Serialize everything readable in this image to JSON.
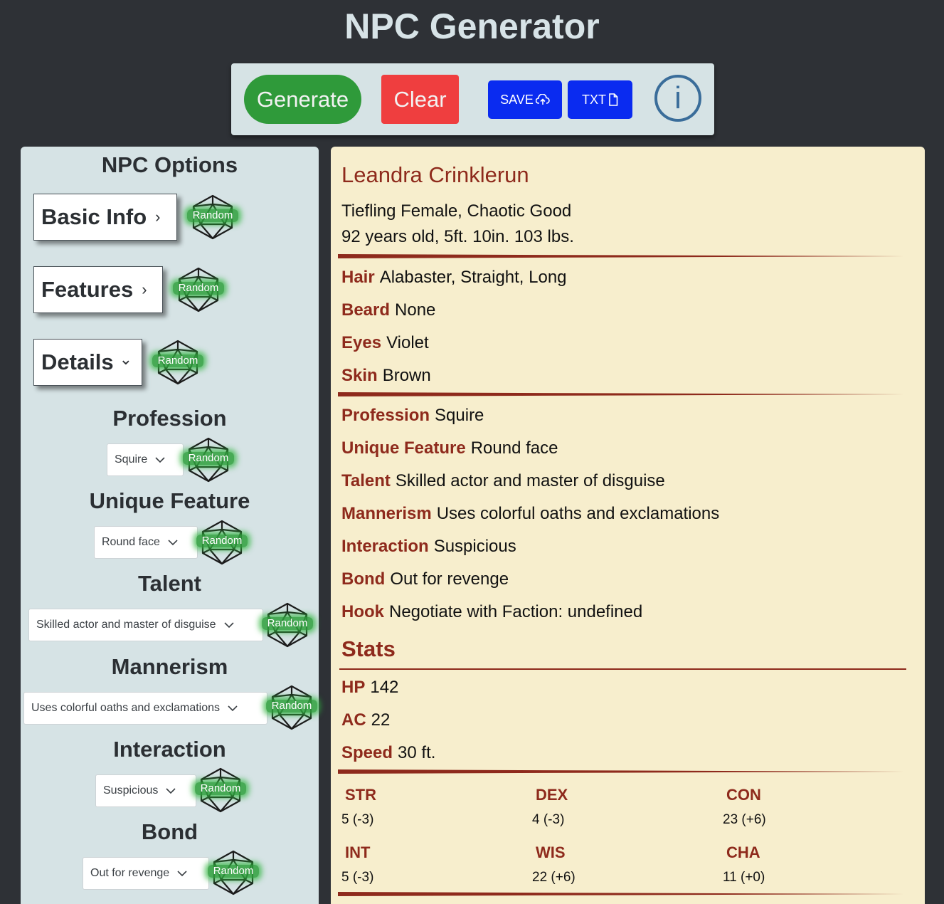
{
  "app": {
    "title": "NPC Generator"
  },
  "toolbar": {
    "generate_label": "Generate",
    "clear_label": "Clear",
    "save_label": "SAVE",
    "txt_label": "TXT",
    "info_label": "i"
  },
  "options": {
    "title": "NPC Options",
    "random_label": "Random",
    "sections": {
      "basic_info": "Basic Info",
      "features": "Features",
      "details": "Details",
      "collapsed_chevron": "›",
      "expanded_chevron": "⌄"
    },
    "fields": {
      "profession": {
        "label": "Profession",
        "value": "Squire"
      },
      "unique_feature": {
        "label": "Unique Feature",
        "value": "Round face"
      },
      "talent": {
        "label": "Talent",
        "value": "Skilled actor and master of disguise"
      },
      "mannerism": {
        "label": "Mannerism",
        "value": "Uses colorful oaths and exclamations"
      },
      "interaction": {
        "label": "Interaction",
        "value": "Suspicious"
      },
      "bond": {
        "label": "Bond",
        "value": "Out for revenge"
      }
    }
  },
  "npc": {
    "name": "Leandra Crinklerun",
    "summary": "Tiefling Female, Chaotic Good",
    "vitals": "92 years old, 5ft. 10in. 103 lbs.",
    "appearance": [
      {
        "key": "Hair",
        "value": "Alabaster, Straight, Long"
      },
      {
        "key": "Beard",
        "value": "None"
      },
      {
        "key": "Eyes",
        "value": "Violet"
      },
      {
        "key": "Skin",
        "value": "Brown"
      }
    ],
    "details": [
      {
        "key": "Profession",
        "value": "Squire"
      },
      {
        "key": "Unique Feature",
        "value": "Round face"
      },
      {
        "key": "Talent",
        "value": "Skilled actor and master of disguise"
      },
      {
        "key": "Mannerism",
        "value": "Uses colorful oaths and exclamations"
      },
      {
        "key": "Interaction",
        "value": "Suspicious"
      },
      {
        "key": "Bond",
        "value": "Out for revenge"
      },
      {
        "key": "Hook",
        "value": "Negotiate with Faction: undefined"
      }
    ],
    "stats_title": "Stats",
    "stats": [
      {
        "key": "HP",
        "value": "142"
      },
      {
        "key": "AC",
        "value": "22"
      },
      {
        "key": "Speed",
        "value": "30 ft."
      }
    ],
    "abilities": [
      {
        "name": "STR",
        "value": "5 (-3)"
      },
      {
        "name": "DEX",
        "value": "4 (-3)"
      },
      {
        "name": "CON",
        "value": "23 (+6)"
      },
      {
        "name": "INT",
        "value": "5 (-3)"
      },
      {
        "name": "WIS",
        "value": "22 (+6)"
      },
      {
        "name": "CHA",
        "value": "11 (+0)"
      }
    ]
  },
  "colors": {
    "background": "#2e3136",
    "panel": "#d6e3e5",
    "parchment": "#f7eecd",
    "accent_red": "#8e2a1c",
    "generate_green": "#2f9a3a",
    "clear_red": "#ef3e3f",
    "action_blue": "#0a2bf0",
    "info_blue": "#3a6d9a"
  },
  "icons": {
    "dice": "d20-icon",
    "save": "cloud-upload-icon",
    "txt": "file-icon",
    "info": "info-icon",
    "caret": "chevron-down-icon"
  }
}
